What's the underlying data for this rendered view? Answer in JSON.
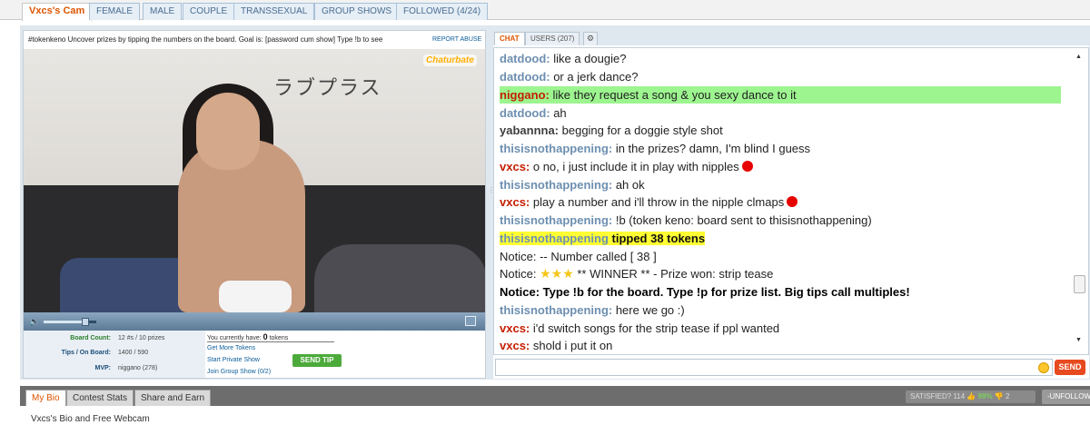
{
  "top_tabs": [
    {
      "label": "Vxcs's Cam",
      "active": true
    },
    {
      "label": "FEMALE"
    },
    {
      "label": "MALE"
    },
    {
      "label": "COUPLE"
    },
    {
      "label": "TRANSSEXUAL"
    },
    {
      "label": "GROUP SHOWS"
    },
    {
      "label": "FOLLOWED (4/24)"
    }
  ],
  "video": {
    "subject": "#tokenkeno Uncover prizes by tipping the numbers on the board. Goal is: [password cum show] Type !b to see",
    "report_label": "REPORT ABUSE",
    "watermark": "Chaturbate",
    "room_text": "ラブプラス",
    "volume_level": 0.8
  },
  "stats": {
    "board_count_label": "Board Count:",
    "board_count_value": "12 #s / 10 prizes",
    "tips_label": "Tips / On Board:",
    "tips_value": "1400 / 590",
    "mvp_label": "MVP:",
    "mvp_value": "niggano (278)"
  },
  "tokens": {
    "have_prefix": "You currently have:",
    "have_count": "0",
    "have_suffix": "tokens",
    "get_more": "Get More Tokens",
    "private_show": "Start Private Show",
    "group_show": "Join Group Show (0/2)",
    "send_tip": "SEND TIP"
  },
  "chat_tabs": {
    "chat": "CHAT",
    "users": "USERS (207)",
    "settings_icon": "gear-icon"
  },
  "messages": [
    {
      "user": "datdood:",
      "text": " like a dougie?"
    },
    {
      "user": "datdood:",
      "text": " or a jerk dance?"
    },
    {
      "user": "niggano:",
      "text": " like they request a song & you sexy dance to it"
    },
    {
      "user": "datdood:",
      "text": " ah"
    },
    {
      "user": "yabannna:",
      "text": " begging for a doggie style shot"
    },
    {
      "user": "thisisnothappening:",
      "text": " in the prizes? damn, I'm blind I guess"
    },
    {
      "user": "vxcs:",
      "text": " o no, i just include it in play with nipples"
    },
    {
      "user": "thisisnothappening:",
      "text": " ah ok"
    },
    {
      "user": "vxcs:",
      "text": " play a number and i'll throw in the nipple clmaps"
    },
    {
      "user": "thisisnothappening:",
      "text": " !b (token keno: board sent to thisisnothappening)"
    },
    {
      "user": "thisisnothappening",
      "text": " tipped 38 tokens"
    },
    {
      "text": "Notice: -- Number called [ 38 ]"
    },
    {
      "prefix": "Notice:",
      "text": " ** WINNER ** - Prize won: strip tease"
    },
    {
      "text": "Notice: Type !b for the board. Type !p for prize list. Big tips call multiples!"
    },
    {
      "user": "thisisnothappening:",
      "text": " here we go :)"
    },
    {
      "user": "vxcs:",
      "text": " i'd switch songs for the strip tease if ppl wanted"
    },
    {
      "user": "vxcs:",
      "text": " shold i put it on"
    }
  ],
  "chat_input": {
    "send_label": "SEND",
    "emoji_icon": "smiley-icon"
  },
  "bottom_tabs": [
    {
      "label": "My Bio",
      "active": true
    },
    {
      "label": "Contest Stats"
    },
    {
      "label": "Share and Earn"
    }
  ],
  "satisfaction": {
    "label": "SATISFIED?",
    "up_count": "114",
    "percent": "99%",
    "down_count": "2"
  },
  "unfollow_label": "-UNFOLLOW",
  "bio_line": "Vxcs's Bio and Free Webcam"
}
